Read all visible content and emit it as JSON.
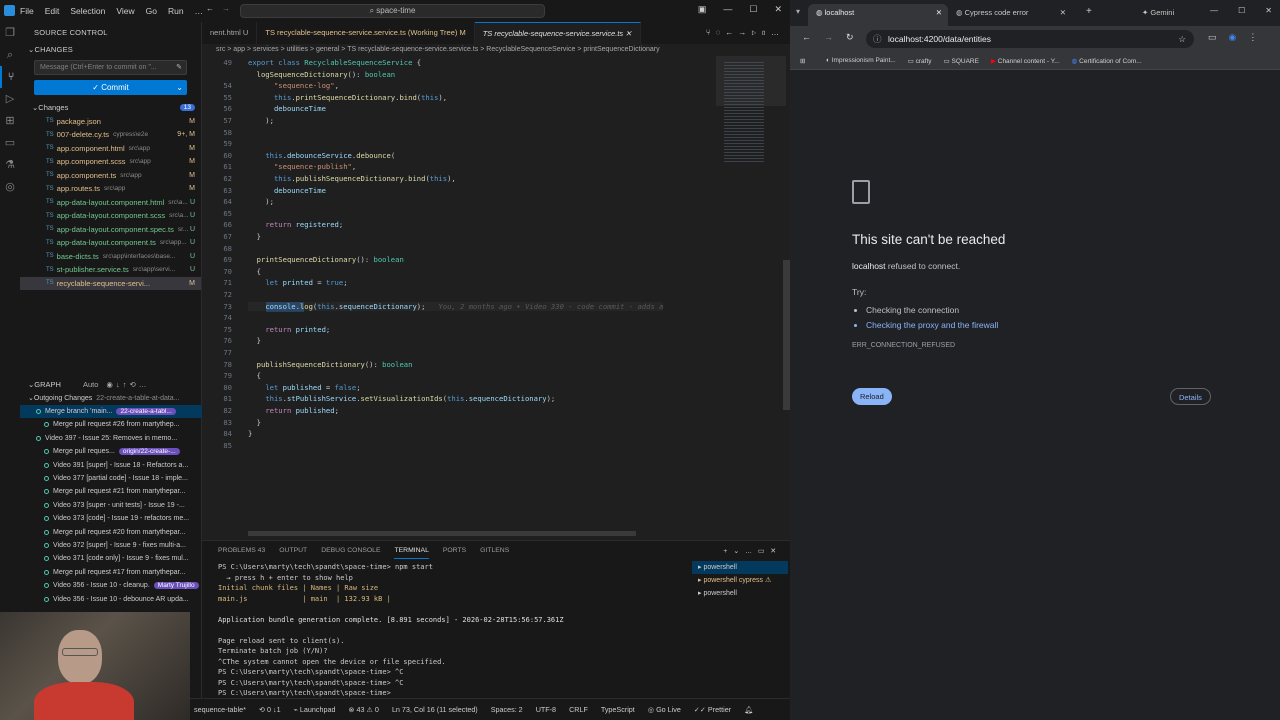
{
  "vscode": {
    "menu": [
      "File",
      "Edit",
      "Selection",
      "View",
      "Go",
      "Run"
    ],
    "search_text": "space-time",
    "sidebar": {
      "title": "SOURCE CONTROL",
      "changes_header": "CHANGES",
      "commit_placeholder": "Message (Ctrl+Enter to commit on \"...",
      "commit_label": "Commit",
      "changes_group": "Changes",
      "changes_count": "13",
      "files": [
        {
          "name": "package.json",
          "path": "",
          "status": "M"
        },
        {
          "name": "007-delete.cy.ts",
          "path": "cypress\\e2e",
          "status": "9+, M"
        },
        {
          "name": "app.component.html",
          "path": "src\\app",
          "status": "M"
        },
        {
          "name": "app.component.scss",
          "path": "src\\app",
          "status": "M"
        },
        {
          "name": "app.component.ts",
          "path": "src\\app",
          "status": "M"
        },
        {
          "name": "app.routes.ts",
          "path": "src\\app",
          "status": "M"
        },
        {
          "name": "app-data-layout.component.html",
          "path": "src\\a...",
          "status": "U"
        },
        {
          "name": "app-data-layout.component.scss",
          "path": "src\\a...",
          "status": "U"
        },
        {
          "name": "app-data-layout.component.spec.ts",
          "path": "sr...",
          "status": "U"
        },
        {
          "name": "app-data-layout.component.ts",
          "path": "src\\app...",
          "status": "U"
        },
        {
          "name": "base-dicts.ts",
          "path": "src\\app\\interfaces\\base...",
          "status": "U"
        },
        {
          "name": "st-publisher.service.ts",
          "path": "src\\app\\servi...",
          "status": "U"
        },
        {
          "name": "recyclable-sequence-servi...",
          "path": "",
          "status": "M"
        }
      ],
      "graph_header": "GRAPH",
      "graph_auto": "Auto",
      "outgoing": "Outgoing Changes",
      "outgoing_badge": "22-create-a-table-at-data...",
      "graph": [
        {
          "text": "Merge branch 'main...",
          "badge": "22-create-a-tabl..."
        },
        {
          "text": "Merge pull request #26 from martythep...",
          "badge": ""
        },
        {
          "text": "Video 397 - Issue 25: Removes in memo...",
          "badge": ""
        },
        {
          "text": "Merge pull reques...",
          "badge": "origin/22-create-..."
        },
        {
          "text": "Video 391 [super] - Issue 18 - Refactors a...",
          "badge": ""
        },
        {
          "text": "Video 377 [partial code] - Issue 18 - imple...",
          "badge": ""
        },
        {
          "text": "Merge pull request #21 from martythepar...",
          "badge": ""
        },
        {
          "text": "Video 373 [super - unit tests] - Issue 19 -...",
          "badge": ""
        },
        {
          "text": "Video 373 [code] - Issue 19 - refactors me...",
          "badge": ""
        },
        {
          "text": "Merge pull request #20 from martythepar...",
          "badge": ""
        },
        {
          "text": "Video 372 [super] - Issue 9 - fixes multi-a...",
          "badge": ""
        },
        {
          "text": "Video 371 [code only] - Issue 9 - fixes mul...",
          "badge": ""
        },
        {
          "text": "Merge pull request #17 from martythepar...",
          "badge": ""
        },
        {
          "text": "Video 356 - Issue 10 - cleanup.",
          "badge": "Marty Trujillo"
        },
        {
          "text": "Video 356 - Issue 10 - debounce AR upda...",
          "badge": ""
        }
      ]
    },
    "tabs": [
      {
        "label": "nent.html U",
        "active": false
      },
      {
        "label": "TS recyclable-sequence-service.service.ts (Working Tree) M",
        "active": false
      },
      {
        "label": "TS recyclable-sequence-service.service.ts",
        "active": true
      }
    ],
    "breadcrumbs": "src > app > services > utilities > general > TS recyclable-sequence-service.service.ts > RecyclableSequenceService > printSequenceDictionary",
    "code_lines": [
      {
        "n": "49",
        "html": "<span class='kw'>export</span> <span class='kw'>class</span> <span class='ty'>RecyclableSequenceService</span> {"
      },
      {
        "n": "",
        "html": "  <span class='fn'>logSequenceDictionary</span>(): <span class='ty'>boolean</span>"
      },
      {
        "n": "54",
        "html": "      <span class='str'>\"sequence-log\"</span>,"
      },
      {
        "n": "55",
        "html": "      <span class='kw'>this</span>.<span class='fn'>printSequenceDictionary</span>.<span class='fn'>bind</span>(<span class='kw'>this</span>),"
      },
      {
        "n": "56",
        "html": "      <span class='var'>debounceTime</span>"
      },
      {
        "n": "57",
        "html": "    );"
      },
      {
        "n": "58",
        "html": ""
      },
      {
        "n": "59",
        "html": ""
      },
      {
        "n": "60",
        "html": "    <span class='kw'>this</span>.<span class='var'>debounceService</span>.<span class='fn'>debounce</span>("
      },
      {
        "n": "61",
        "html": "      <span class='str'>\"sequence-publish\"</span>,"
      },
      {
        "n": "62",
        "html": "      <span class='kw'>this</span>.<span class='fn'>publishSequenceDictionary</span>.<span class='fn'>bind</span>(<span class='kw'>this</span>),"
      },
      {
        "n": "63",
        "html": "      <span class='var'>debounceTime</span>"
      },
      {
        "n": "64",
        "html": "    );"
      },
      {
        "n": "65",
        "html": ""
      },
      {
        "n": "66",
        "html": "    <span class='kw2'>return</span> <span class='var'>registered</span>;"
      },
      {
        "n": "67",
        "html": "  }"
      },
      {
        "n": "68",
        "html": ""
      },
      {
        "n": "69",
        "html": "  <span class='fn'>printSequenceDictionary</span>(): <span class='ty'>boolean</span>"
      },
      {
        "n": "70",
        "html": "  {"
      },
      {
        "n": "71",
        "html": "    <span class='kw'>let</span> <span class='var'>printed</span> = <span class='kw'>true</span>;"
      },
      {
        "n": "72",
        "html": ""
      },
      {
        "n": "73",
        "html": "    <span class='var'>console</span>.<span class='fn'>log</span>(<span class='kw'>this</span>.<span class='var'>sequenceDictionary</span>);   <span class='hint'>You, 2 months ago • Video 330 - code commit - adds a</span>"
      },
      {
        "n": "74",
        "html": ""
      },
      {
        "n": "75",
        "html": "    <span class='kw2'>return</span> <span class='var'>printed</span>;"
      },
      {
        "n": "76",
        "html": "  }"
      },
      {
        "n": "77",
        "html": ""
      },
      {
        "n": "78",
        "html": "  <span class='fn'>publishSequenceDictionary</span>(): <span class='ty'>boolean</span>"
      },
      {
        "n": "79",
        "html": "  {"
      },
      {
        "n": "80",
        "html": "    <span class='kw'>let</span> <span class='var'>published</span> = <span class='kw'>false</span>;"
      },
      {
        "n": "81",
        "html": "    <span class='kw'>this</span>.<span class='var'>stPublishService</span>.<span class='fn'>setVisualizationIds</span>(<span class='kw'>this</span>.<span class='var'>sequenceDictionary</span>);"
      },
      {
        "n": "82",
        "html": "    <span class='kw2'>return</span> <span class='var'>published</span>;"
      },
      {
        "n": "83",
        "html": "  }"
      },
      {
        "n": "84",
        "html": "}"
      },
      {
        "n": "85",
        "html": ""
      }
    ],
    "panel_tabs": [
      "PROBLEMS 43",
      "OUTPUT",
      "DEBUG CONSOLE",
      "TERMINAL",
      "PORTS",
      "GITLENS"
    ],
    "terminal_lines": [
      "PS C:\\Users\\marty\\tech\\spandt\\space-time> npm start",
      "  → press h + enter to show help",
      "Initial chunk files | Names | Raw size",
      "main.js             | main  | 132.93 kB |",
      "",
      "Application bundle generation complete. [8.891 seconds] - 2026-02-28T15:56:57.361Z",
      "",
      "Page reload sent to client(s).",
      "Terminate batch job (Y/N)?",
      "^CThe system cannot open the device or file specified.",
      "PS C:\\Users\\marty\\tech\\spandt\\space-time> ^C",
      "PS C:\\Users\\marty\\tech\\spandt\\space-time> ^C",
      "PS C:\\Users\\marty\\tech\\spandt\\space-time> "
    ],
    "terminals": [
      "powershell",
      "powershell cypress",
      "powershell"
    ],
    "status": {
      "branch": "sequence-table*",
      "sync": "0 ↓1",
      "launchpad": "Launchpad",
      "problems": "⊗ 43 ⚠ 0",
      "cursor": "Ln 73, Col 16 (11 selected)",
      "spaces": "Spaces: 2",
      "encoding": "UTF-8",
      "eol": "CRLF",
      "lang": "TypeScript",
      "golive": "Go Live",
      "prettier": "Prettier"
    }
  },
  "chrome": {
    "tabs": [
      {
        "label": "localhost",
        "active": true
      },
      {
        "label": "Cypress code error",
        "active": false
      },
      {
        "label": "Gemini",
        "active": false
      }
    ],
    "url": "localhost:4200/data/entities",
    "bookmarks": [
      "Impressionism Paint...",
      "crafty",
      "SQUARE",
      "Channel content - Y...",
      "Certification of Com..."
    ],
    "error": {
      "title": "This site can't be reached",
      "host": "localhost",
      "subtitle": " refused to connect.",
      "try": "Try:",
      "suggestions": [
        "Checking the connection",
        "Checking the proxy and the firewall"
      ],
      "code": "ERR_CONNECTION_REFUSED",
      "reload": "Reload",
      "details": "Details"
    }
  }
}
